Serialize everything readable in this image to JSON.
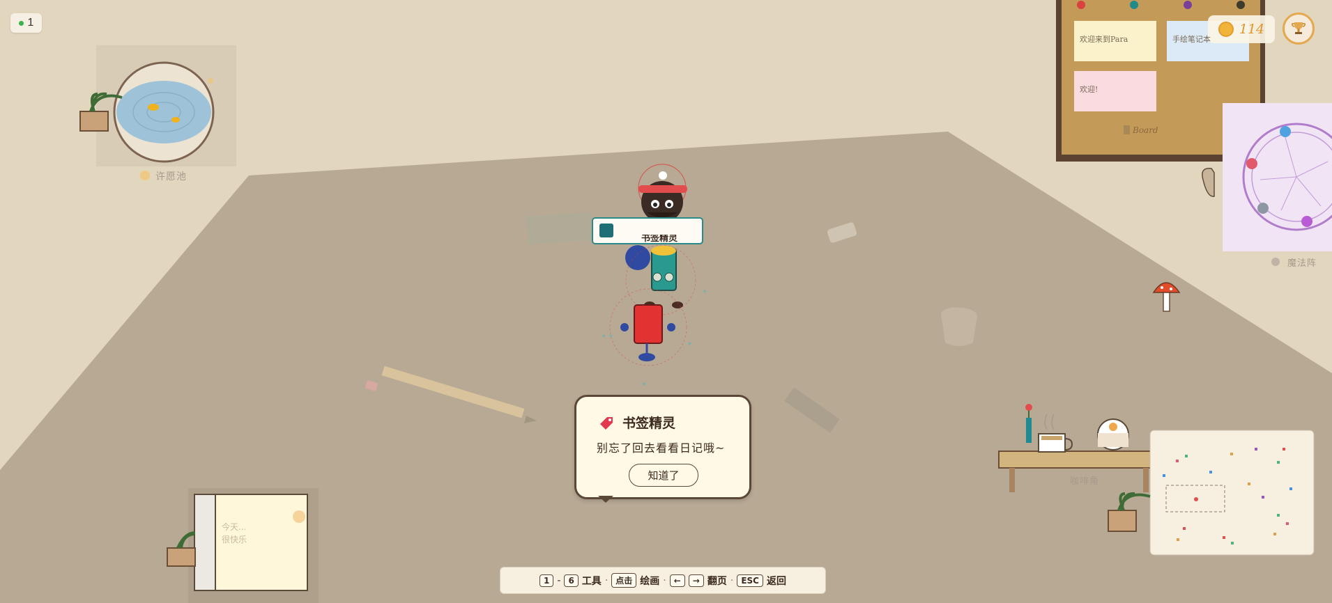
{
  "hud": {
    "online_count": "1",
    "coins": "114"
  },
  "wishing_pool": {
    "label": "许愿池"
  },
  "board": {
    "notes": [
      "欢迎来到Para",
      "手绘笔记本",
      "欢迎!"
    ],
    "label": "Board"
  },
  "magic_wand": {
    "label": "魔法阵"
  },
  "coffee_corner": {
    "label": "咖啡角"
  },
  "notebook": {
    "lines": [
      "今天...",
      "很快乐"
    ]
  },
  "player_tag": {
    "name": "书签精灵"
  },
  "dialog": {
    "title": "书签精灵",
    "message": "别忘了回去看看日记哦~",
    "button": "知道了"
  },
  "hint_bar": {
    "k1": "1",
    "dash": "-",
    "k2": "6",
    "tool": "工具",
    "dot1": "·",
    "click_key": "点击",
    "draw": "绘画",
    "dot2": "·",
    "left_key": "←",
    "right_key": "→",
    "page": "翻页",
    "dot3": "·",
    "esc_key": "ESC",
    "back": "返回"
  },
  "colors": {
    "wall": "#e2d6bf",
    "floor": "#b8a994",
    "accent": "#e4a84e",
    "dialog_bg": "#fff9e6"
  }
}
